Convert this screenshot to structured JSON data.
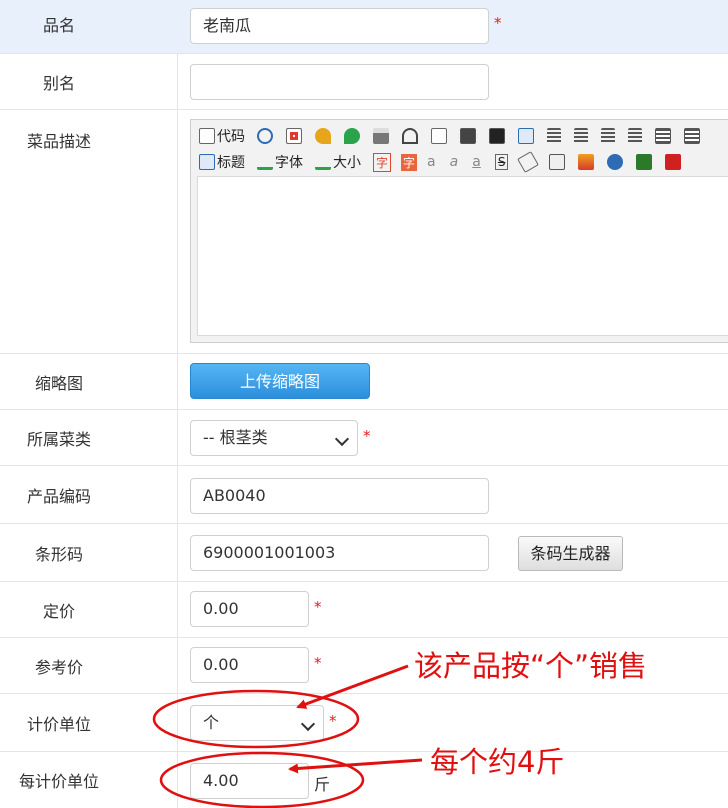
{
  "form": {
    "name": {
      "label": "品名",
      "value": "老南瓜",
      "required": "*"
    },
    "alias": {
      "label": "别名",
      "value": ""
    },
    "description": {
      "label": "菜品描述",
      "toolbar_row1": [
        {
          "icon": "code-icon",
          "text": "代码"
        },
        {
          "icon": "preview-icon",
          "text": ""
        },
        {
          "icon": "fullscreen-icon",
          "text": ""
        },
        {
          "icon": "undo-icon",
          "text": ""
        },
        {
          "icon": "redo-icon",
          "text": ""
        },
        {
          "icon": "print-icon",
          "text": ""
        },
        {
          "icon": "cut-icon",
          "text": ""
        },
        {
          "icon": "copy-icon",
          "text": ""
        },
        {
          "icon": "paste-icon",
          "text": ""
        },
        {
          "icon": "paste-text-icon",
          "text": ""
        },
        {
          "icon": "paste-word-icon",
          "text": ""
        },
        {
          "icon": "align-left-icon",
          "text": ""
        },
        {
          "icon": "align-center-icon",
          "text": ""
        },
        {
          "icon": "align-right-icon",
          "text": ""
        },
        {
          "icon": "align-justify-icon",
          "text": ""
        },
        {
          "icon": "ordered-list-icon",
          "text": ""
        },
        {
          "icon": "unordered-list-icon",
          "text": ""
        }
      ],
      "toolbar_row2": [
        {
          "icon": "heading-icon",
          "text": "标题"
        },
        {
          "icon": "font-icon",
          "text": "字体"
        },
        {
          "icon": "font-size-icon",
          "text": "大小"
        },
        {
          "icon": "font-color-icon",
          "text": "字"
        },
        {
          "icon": "highlight-icon",
          "text": "字"
        },
        {
          "icon": "bold-icon",
          "text": "a"
        },
        {
          "icon": "italic-icon",
          "text": "a"
        },
        {
          "icon": "underline-icon",
          "text": "a"
        },
        {
          "icon": "strikethrough-icon",
          "text": "S"
        },
        {
          "icon": "eraser-icon",
          "text": ""
        },
        {
          "icon": "template-icon",
          "text": ""
        },
        {
          "icon": "image-icon",
          "text": ""
        },
        {
          "icon": "flash-icon",
          "text": ""
        },
        {
          "icon": "media-icon",
          "text": ""
        },
        {
          "icon": "table-icon",
          "text": ""
        }
      ]
    },
    "thumbnail": {
      "label": "缩略图",
      "button": "上传缩略图"
    },
    "category": {
      "label": "所属菜类",
      "value": "-- 根茎类",
      "required": "*"
    },
    "product_code": {
      "label": "产品编码",
      "value": "AB0040"
    },
    "barcode": {
      "label": "条形码",
      "value": "6900001001003",
      "button": "条码生成器"
    },
    "fixed_price": {
      "label": "定价",
      "value": "0.00",
      "required": "*"
    },
    "ref_price": {
      "label": "参考价",
      "value": "0.00",
      "required": "*"
    },
    "pricing_unit": {
      "label": "计价单位",
      "value": "个",
      "required": "*"
    },
    "per_unit": {
      "label": "每计价单位",
      "value": "4.00",
      "unit": "斤"
    }
  },
  "annotations": {
    "unit_note": "该产品按“个”销售",
    "weight_note": "每个约4斤",
    "color": "#e01010"
  }
}
